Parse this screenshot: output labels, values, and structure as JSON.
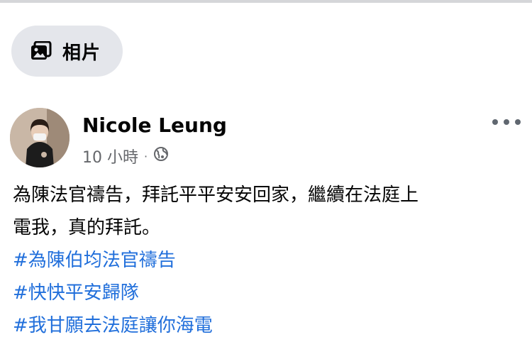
{
  "photos_chip": {
    "label": "相片",
    "icon": "photo-icon"
  },
  "post": {
    "author": "Nicole Leung",
    "time": "10 小時",
    "separator": "·",
    "privacy_icon": "globe-icon",
    "text_line_1": "為陳法官禱告，拜託平平安安回家，繼續在法庭上",
    "text_line_2": "電我，真的拜託。",
    "hashtags": [
      "#為陳伯均法官禱告",
      "#快快平安歸隊",
      "#我甘願去法庭讓你海電"
    ]
  },
  "colors": {
    "link": "#216fdb",
    "chip_bg": "#e4e6eb",
    "secondary_text": "#65676b"
  }
}
